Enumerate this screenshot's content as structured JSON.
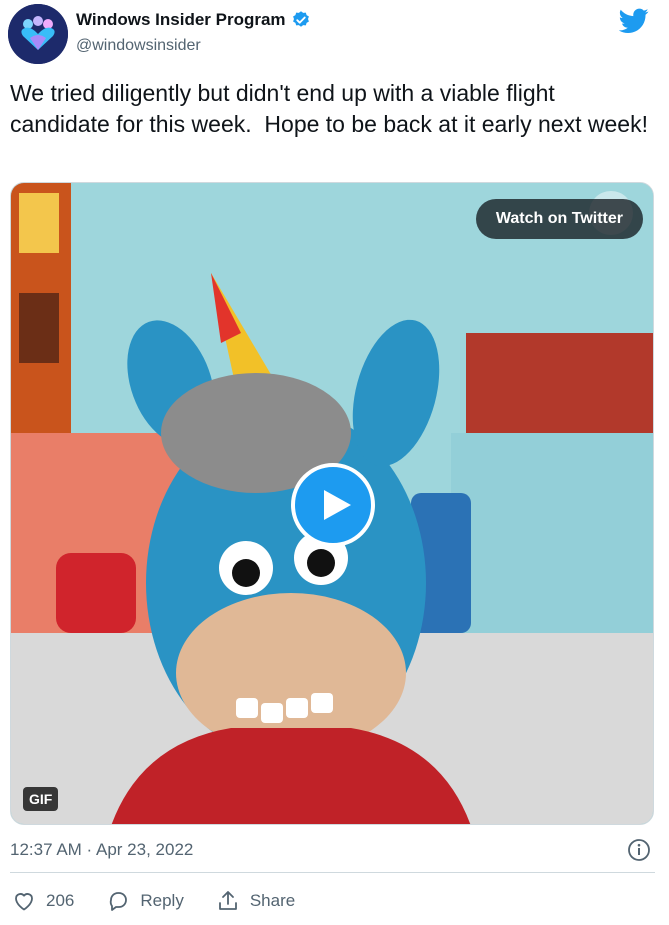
{
  "account": {
    "display_name": "Windows Insider Program",
    "handle": "@windowsinsider",
    "verified": true,
    "avatar_icon": "windows-insider-people-icon",
    "brand_color": "#1d9bf0"
  },
  "tweet": {
    "text": "We tried diligently but didn't end up with a viable flight candidate for this week.  Hope to be back at it early next week!"
  },
  "media": {
    "watch_label": "Watch on Twitter",
    "badge": "GIF",
    "play_icon": "play-icon"
  },
  "meta": {
    "timestamp": "12:37 AM · Apr 23, 2022",
    "info_icon": "info-icon"
  },
  "actions": {
    "like_count": "206",
    "reply_label": "Reply",
    "share_label": "Share"
  }
}
